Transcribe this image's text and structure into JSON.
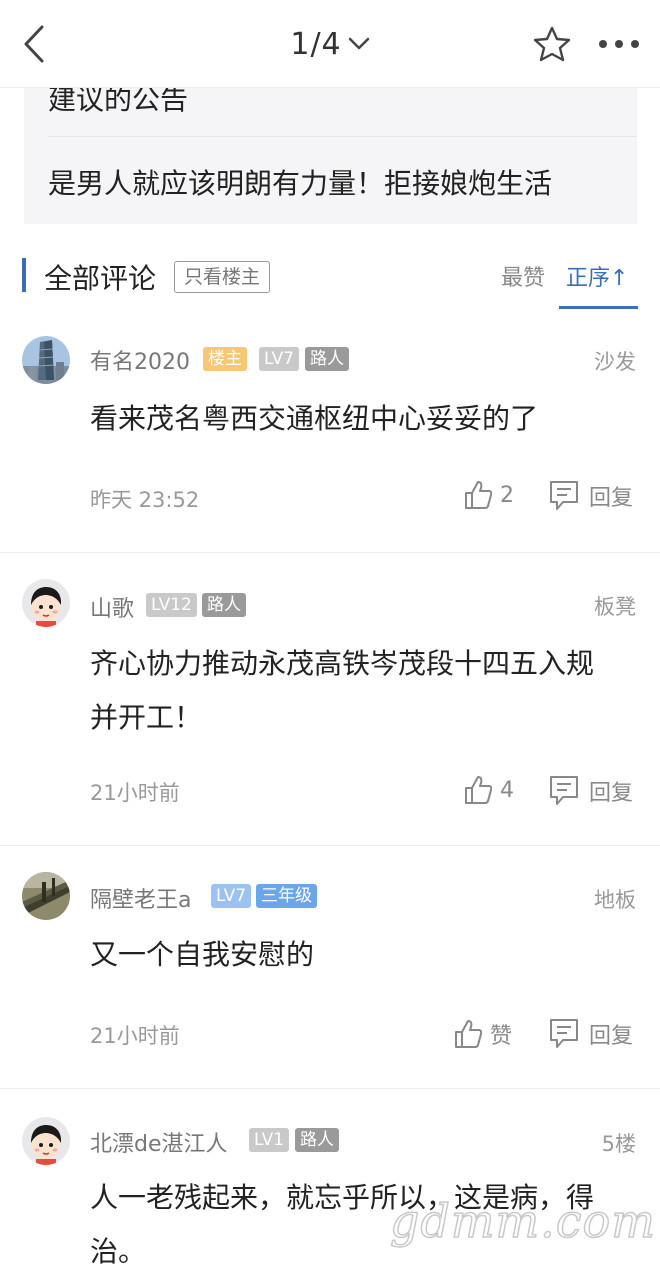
{
  "topbar": {
    "page_indicator": "1/4",
    "icons": {
      "back": "chevron-left-icon",
      "pager": "chevron-down-icon",
      "favorite": "star-outline-icon",
      "more": "more-dots-icon"
    }
  },
  "related_posts": [
    {
      "title": "建议的公告"
    },
    {
      "title": "是男人就应该明朗有力量！拒接娘炮生活"
    }
  ],
  "comments_header": {
    "title": "全部评论",
    "owner_only_label": "只看楼主",
    "sort_likes_label": "最赞",
    "sort_order_label": "正序↑"
  },
  "colors": {
    "accent": "#3a6fb7",
    "owner_badge": "#f7c773",
    "grade_badge": "#6ba6ea"
  },
  "comments": [
    {
      "author": "有名2020",
      "badges": [
        "楼主",
        "LV7",
        "路人"
      ],
      "floor": "沙发",
      "text": "看来茂名粤西交通枢纽中心妥妥的了",
      "time": "昨天 23:52",
      "likes": "2",
      "reply_label": "回复",
      "avatar": "building-avatar"
    },
    {
      "author": "山歌",
      "badges": [
        "LV12",
        "路人"
      ],
      "floor": "板凳",
      "text": "齐心协力推动永茂高铁岑茂段十四五入规并开工！",
      "time": "21小时前",
      "likes": "4",
      "reply_label": "回复",
      "avatar": "cartoon-avatar"
    },
    {
      "author": "隔壁老王a",
      "badges": [
        "LV7",
        "三年级"
      ],
      "floor": "地板",
      "text": "又一个自我安慰的",
      "time": "21小时前",
      "likes": "赞",
      "reply_label": "回复",
      "avatar": "photo-avatar"
    },
    {
      "author": "北漂de湛江人",
      "badges": [
        "LV1",
        "路人"
      ],
      "floor": "5楼",
      "text": "人一老残起来，就忘乎所以，这是病，得治。",
      "avatar": "cartoon-avatar"
    }
  ],
  "watermark": "gdmm.com"
}
